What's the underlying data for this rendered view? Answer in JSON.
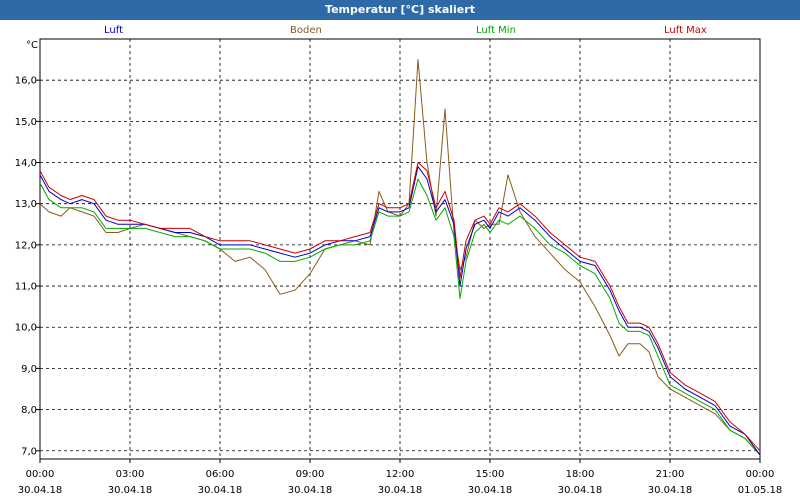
{
  "window": {
    "title": "Temperatur [°C] skaliert"
  },
  "chart_data": {
    "type": "line",
    "title": "Temperatur [°C] skaliert",
    "ylabel": "°C",
    "xlabel": "",
    "ylim": [
      6.8,
      17.0
    ],
    "xlim": [
      0,
      24
    ],
    "grid": true,
    "legend_placement": "top",
    "yticks": [
      7.0,
      8.0,
      9.0,
      10.0,
      11.0,
      12.0,
      13.0,
      14.0,
      15.0,
      16.0
    ],
    "ytick_labels": [
      "7,0",
      "8,0",
      "9,0",
      "10,0",
      "11,0",
      "12,0",
      "13,0",
      "14,0",
      "15,0",
      "16,0"
    ],
    "xticks": [
      {
        "pos": 0,
        "time": "00:00",
        "date": "30.04.18"
      },
      {
        "pos": 3,
        "time": "03:00",
        "date": "30.04.18"
      },
      {
        "pos": 6,
        "time": "06:00",
        "date": "30.04.18"
      },
      {
        "pos": 9,
        "time": "09:00",
        "date": "30.04.18"
      },
      {
        "pos": 12,
        "time": "12:00",
        "date": "30.04.18"
      },
      {
        "pos": 15,
        "time": "15:00",
        "date": "30.04.18"
      },
      {
        "pos": 18,
        "time": "18:00",
        "date": "30.04.18"
      },
      {
        "pos": 21,
        "time": "21:00",
        "date": "30.04.18"
      },
      {
        "pos": 24,
        "time": "00:00",
        "date": "01.05.18"
      }
    ],
    "series": [
      {
        "name": "Luft",
        "color": "#0000cc",
        "x": [
          0,
          0.3,
          0.7,
          1,
          1.4,
          1.8,
          2.2,
          2.6,
          3,
          3.5,
          4,
          4.5,
          5,
          5.5,
          6,
          6.5,
          7,
          7.5,
          8,
          8.5,
          9,
          9.5,
          10,
          10.5,
          11,
          11.3,
          11.6,
          12,
          12.3,
          12.6,
          12.9,
          13.2,
          13.5,
          13.8,
          14,
          14.2,
          14.5,
          14.8,
          15,
          15.3,
          15.6,
          16,
          16.5,
          17,
          17.5,
          18,
          18.5,
          19,
          19.3,
          19.6,
          20,
          20.3,
          20.6,
          21,
          21.5,
          22,
          22.5,
          23,
          23.5,
          24
        ],
        "y": [
          13.7,
          13.3,
          13.1,
          13.0,
          13.1,
          13.0,
          12.6,
          12.5,
          12.5,
          12.5,
          12.4,
          12.3,
          12.3,
          12.2,
          12.0,
          12.0,
          12.0,
          11.9,
          11.8,
          11.7,
          11.8,
          12.0,
          12.1,
          12.1,
          12.2,
          12.9,
          12.8,
          12.8,
          12.9,
          13.9,
          13.6,
          12.8,
          13.1,
          12.5,
          11.0,
          11.9,
          12.5,
          12.6,
          12.4,
          12.8,
          12.7,
          12.9,
          12.6,
          12.2,
          11.9,
          11.6,
          11.5,
          10.9,
          10.4,
          10.0,
          10.0,
          9.9,
          9.5,
          8.8,
          8.5,
          8.3,
          8.1,
          7.6,
          7.4,
          6.9
        ]
      },
      {
        "name": "Boden",
        "color": "#8b5a1a",
        "x": [
          0,
          0.3,
          0.7,
          1,
          1.4,
          1.8,
          2.2,
          2.6,
          3,
          3.5,
          4,
          4.5,
          5,
          5.5,
          6,
          6.5,
          7,
          7.5,
          8,
          8.5,
          9,
          9.5,
          10,
          10.5,
          11,
          11.3,
          11.6,
          12,
          12.3,
          12.6,
          12.9,
          13.2,
          13.5,
          13.8,
          14,
          14.2,
          14.5,
          14.8,
          15,
          15.3,
          15.6,
          16,
          16.5,
          17,
          17.5,
          18,
          18.5,
          19,
          19.3,
          19.6,
          20,
          20.3,
          20.6,
          21,
          21.5,
          22,
          22.5,
          23,
          23.5,
          24
        ],
        "y": [
          13.0,
          12.8,
          12.7,
          12.9,
          12.8,
          12.7,
          12.3,
          12.3,
          12.4,
          12.5,
          12.4,
          12.3,
          12.2,
          12.1,
          11.9,
          11.6,
          11.7,
          11.4,
          10.8,
          10.9,
          11.3,
          11.9,
          12.0,
          12.1,
          12.0,
          13.3,
          12.8,
          12.7,
          13.0,
          16.5,
          14.0,
          12.7,
          15.3,
          12.3,
          11.4,
          11.7,
          12.6,
          12.4,
          12.5,
          12.5,
          13.7,
          12.8,
          12.2,
          11.8,
          11.4,
          11.1,
          10.5,
          9.8,
          9.3,
          9.6,
          9.6,
          9.4,
          8.8,
          8.5,
          8.3,
          8.1,
          7.9,
          7.5,
          7.3,
          6.9
        ]
      },
      {
        "name": "Luft Min",
        "color": "#00aa00",
        "x": [
          0,
          0.3,
          0.7,
          1,
          1.4,
          1.8,
          2.2,
          2.6,
          3,
          3.5,
          4,
          4.5,
          5,
          5.5,
          6,
          6.5,
          7,
          7.5,
          8,
          8.5,
          9,
          9.5,
          10,
          10.5,
          11,
          11.3,
          11.6,
          12,
          12.3,
          12.6,
          12.9,
          13.2,
          13.5,
          13.8,
          14,
          14.2,
          14.5,
          14.8,
          15,
          15.3,
          15.6,
          16,
          16.5,
          17,
          17.5,
          18,
          18.5,
          19,
          19.3,
          19.6,
          20,
          20.3,
          20.6,
          21,
          21.5,
          22,
          22.5,
          23,
          23.5,
          24
        ],
        "y": [
          13.5,
          13.1,
          12.9,
          12.9,
          12.9,
          12.8,
          12.4,
          12.4,
          12.4,
          12.4,
          12.3,
          12.2,
          12.2,
          12.1,
          11.9,
          11.9,
          11.9,
          11.8,
          11.6,
          11.6,
          11.7,
          11.9,
          12.0,
          12.0,
          12.1,
          12.8,
          12.7,
          12.7,
          12.8,
          13.6,
          13.2,
          12.6,
          12.9,
          12.2,
          10.7,
          11.6,
          12.3,
          12.5,
          12.3,
          12.6,
          12.5,
          12.7,
          12.4,
          12.0,
          11.8,
          11.5,
          11.3,
          10.7,
          10.1,
          9.9,
          9.9,
          9.8,
          9.3,
          8.6,
          8.4,
          8.2,
          8.0,
          7.5,
          7.3,
          6.9
        ]
      },
      {
        "name": "Luft Max",
        "color": "#cc0000",
        "x": [
          0,
          0.3,
          0.7,
          1,
          1.4,
          1.8,
          2.2,
          2.6,
          3,
          3.5,
          4,
          4.5,
          5,
          5.5,
          6,
          6.5,
          7,
          7.5,
          8,
          8.5,
          9,
          9.5,
          10,
          10.5,
          11,
          11.3,
          11.6,
          12,
          12.3,
          12.6,
          12.9,
          13.2,
          13.5,
          13.8,
          14,
          14.2,
          14.5,
          14.8,
          15,
          15.3,
          15.6,
          16,
          16.5,
          17,
          17.5,
          18,
          18.5,
          19,
          19.3,
          19.6,
          20,
          20.3,
          20.6,
          21,
          21.5,
          22,
          22.5,
          23,
          23.5,
          24
        ],
        "y": [
          13.8,
          13.4,
          13.2,
          13.1,
          13.2,
          13.1,
          12.7,
          12.6,
          12.6,
          12.5,
          12.4,
          12.4,
          12.4,
          12.2,
          12.1,
          12.1,
          12.1,
          12.0,
          11.9,
          11.8,
          11.9,
          12.1,
          12.1,
          12.2,
          12.3,
          13.0,
          12.9,
          12.9,
          13.0,
          14.0,
          13.8,
          12.9,
          13.3,
          12.6,
          11.2,
          12.1,
          12.6,
          12.7,
          12.5,
          12.9,
          12.8,
          13.0,
          12.7,
          12.3,
          12.0,
          11.7,
          11.6,
          11.0,
          10.5,
          10.1,
          10.1,
          10.0,
          9.6,
          8.9,
          8.6,
          8.4,
          8.2,
          7.7,
          7.4,
          7.0
        ]
      }
    ]
  }
}
